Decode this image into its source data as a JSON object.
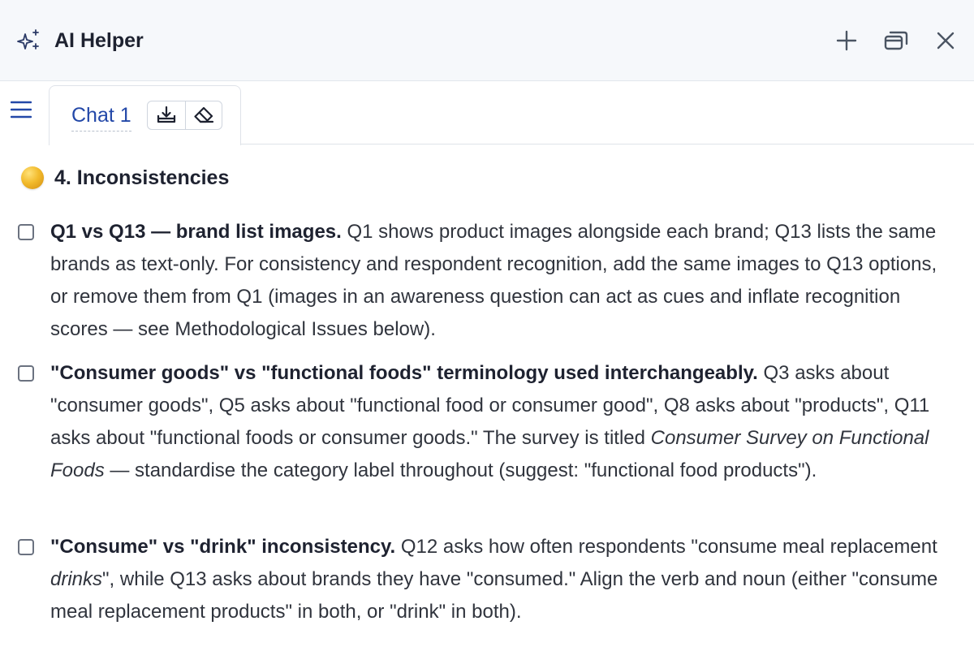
{
  "header": {
    "title": "AI Helper",
    "icons": [
      "sparkle-icon",
      "plus-icon",
      "restore-window-icon",
      "close-icon"
    ]
  },
  "tabs": [
    {
      "label": "Chat 1",
      "actions": [
        "download-icon",
        "eraser-icon"
      ]
    }
  ],
  "menu_icon": "hamburger-menu-icon",
  "section": {
    "title": "4. Inconsistencies",
    "icon": "yellow-circle-icon",
    "icon_color": "#f2bb2d"
  },
  "items": [
    {
      "checked": false,
      "bold": "Q1 vs Q13 — brand list images.",
      "text": " Q1 shows product images alongside each brand; Q13 lists the same brands as text-only. For consistency and respondent recognition, add the same images to Q13 options, or remove them from Q1 (images in an awareness question can act as cues and inflate recognition scores — see Methodological Issues below)."
    },
    {
      "checked": false,
      "bold": "\"Consumer goods\" vs \"functional foods\" terminology used interchangeably.",
      "text_a": " Q3 asks about \"consumer goods\", Q5 asks about \"functional food or consumer good\", Q8 asks about \"products\", Q11 asks about \"functional foods or consumer goods.\" The survey is titled ",
      "italic": "Consumer Survey on Functional Foods",
      "text_b": " — standardise the category label throughout (suggest: \"functional food products\")."
    },
    {
      "checked": false,
      "bold": "\"Consume\" vs \"drink\" inconsistency.",
      "text_a": " Q12 asks how often respondents \"consume meal replacement ",
      "italic": "drinks",
      "text_b": "\", while Q13 asks about brands they have \"consumed.\" Align the verb and noun (either \"consume meal replacement products\" in both, or \"drink\" in both)."
    }
  ],
  "colors": {
    "accent": "#2348a8",
    "header_bg": "#f6f8fb",
    "text": "#30343d"
  }
}
